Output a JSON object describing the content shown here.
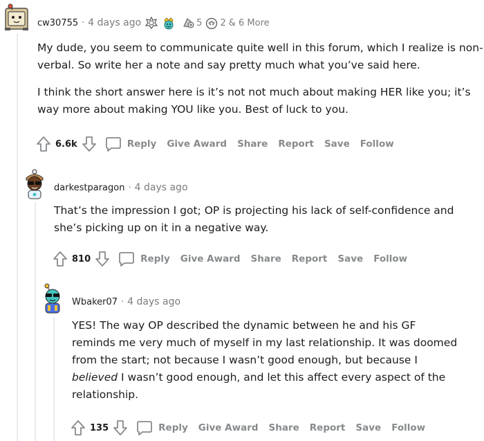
{
  "comments": [
    {
      "username": "cw30755",
      "separator": "·",
      "time": "4 days ago",
      "awards": [
        {
          "icon": "wholesome-seal-icon",
          "count": ""
        },
        {
          "icon": "crown-face-award-icon",
          "count": ""
        },
        {
          "icon": "rocket-like-award-icon",
          "count": "5"
        },
        {
          "icon": "helpful-award-icon",
          "count": "2"
        }
      ],
      "more_awards": "& 6 More",
      "paragraphs": [
        "My dude, you seem to communicate quite well in this forum, which I realize is non-verbal. So write her a note and say pretty much what you’ve said here.",
        "I think the short answer here is it’s not not much about making HER like you; it’s way more about making YOU like you. Best of luck to you."
      ],
      "score": "6.6k"
    },
    {
      "username": "darkestparagon",
      "separator": "·",
      "time": "4 days ago",
      "paragraphs": [
        "That’s the impression I got; OP is projecting his lack of self-confidence and she’s picking up on it in a negative way."
      ],
      "score": "810"
    },
    {
      "username": "Wbaker07",
      "separator": "·",
      "time": "4 days ago",
      "paragraph_parts": [
        "YES! The way OP described the dynamic between he and his GF reminds me very much of myself in my last relationship. It was doomed from the start; not because I wasn’t good enough, but because I ",
        "believed",
        " I wasn’t good enough, and let this affect every aspect of the relationship."
      ],
      "score": "135"
    }
  ],
  "actions": {
    "reply": "Reply",
    "give_award": "Give Award",
    "share": "Share",
    "report": "Report",
    "save": "Save",
    "follow": "Follow"
  },
  "colors": {
    "text": "#1c1c1c",
    "meta": "#7c7c7c",
    "action": "#878a8c",
    "thread_line": "#e9ebed"
  }
}
